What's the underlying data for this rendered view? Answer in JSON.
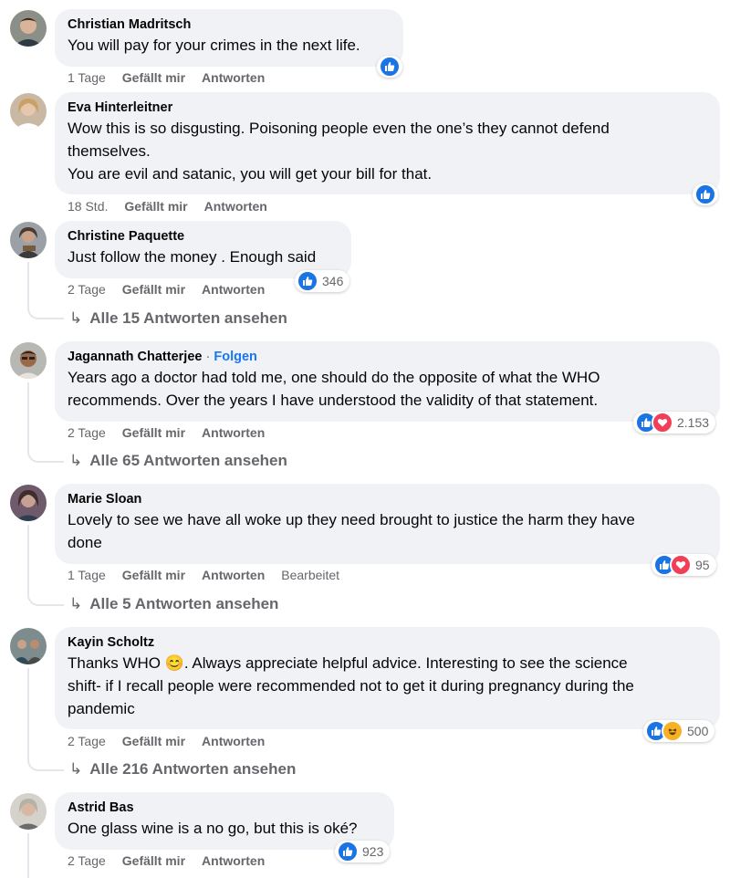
{
  "comments": [
    {
      "author": "Christian Madritsch",
      "text": [
        "You will pay for your crimes in the next life."
      ],
      "time": "1 Tage",
      "like": "Gefällt mir",
      "reply": "Antworten",
      "reactions": {
        "types": [
          "like"
        ],
        "count": ""
      }
    },
    {
      "author": "Eva Hinterleitner",
      "text": [
        "Wow this is so disgusting. Poisoning people even the one’s they cannot defend",
        "themselves.",
        "You are evil and satanic, you will get your bill for that."
      ],
      "time": "18 Std.",
      "like": "Gefällt mir",
      "reply": "Antworten",
      "reactions": {
        "types": [
          "like"
        ],
        "count": ""
      }
    },
    {
      "author": "Christine Paquette",
      "text": [
        "Just follow the money . Enough said"
      ],
      "time": "2 Tage",
      "like": "Gefällt mir",
      "reply": "Antworten",
      "reactions": {
        "types": [
          "like"
        ],
        "count": "346"
      },
      "replies_label": "Alle 15 Antworten ansehen"
    },
    {
      "author": "Jagannath Chatterjee",
      "follow": "Folgen",
      "text": [
        "Years ago a doctor had told me, one should do the opposite of what the WHO",
        "recommends. Over the years I have understood the validity of that statement."
      ],
      "time": "2 Tage",
      "like": "Gefällt mir",
      "reply": "Antworten",
      "reactions": {
        "types": [
          "like",
          "love"
        ],
        "count": "2.153"
      },
      "replies_label": "Alle 65 Antworten ansehen"
    },
    {
      "author": "Marie Sloan",
      "text": [
        "Lovely to see we have all woke up they need brought to justice the harm they have",
        "done"
      ],
      "time": "1 Tage",
      "like": "Gefällt mir",
      "reply": "Antworten",
      "edited": "Bearbeitet",
      "reactions": {
        "types": [
          "like",
          "love"
        ],
        "count": "95"
      },
      "replies_label": "Alle 5 Antworten ansehen"
    },
    {
      "author": "Kayin Scholtz",
      "text": [
        "Thanks WHO 😊. Always appreciate helpful advice. Interesting to see the science",
        "shift- if I recall people were recommended not to get it during pregnancy during the",
        "pandemic"
      ],
      "time": "2 Tage",
      "like": "Gefällt mir",
      "reply": "Antworten",
      "reactions": {
        "types": [
          "like",
          "haha"
        ],
        "count": "500"
      },
      "replies_label": "Alle 216 Antworten ansehen"
    },
    {
      "author": "Astrid Bas",
      "text": [
        "One glass wine is a no go, but this is oké?"
      ],
      "time": "2 Tage",
      "like": "Gefällt mir",
      "reply": "Antworten",
      "reactions": {
        "types": [
          "like"
        ],
        "count": "923"
      }
    }
  ],
  "colors": {
    "bubble": "#f0f2f5",
    "meta": "#65676b",
    "like": "#1b74e4",
    "love": "#f33e58",
    "haha": "#f7b125",
    "follow": "#1877f2"
  },
  "icons": {
    "like": "thumbs-up-icon",
    "love": "heart-icon",
    "haha": "laughing-face-icon",
    "reply_arrow": "reply-arrow-icon"
  }
}
